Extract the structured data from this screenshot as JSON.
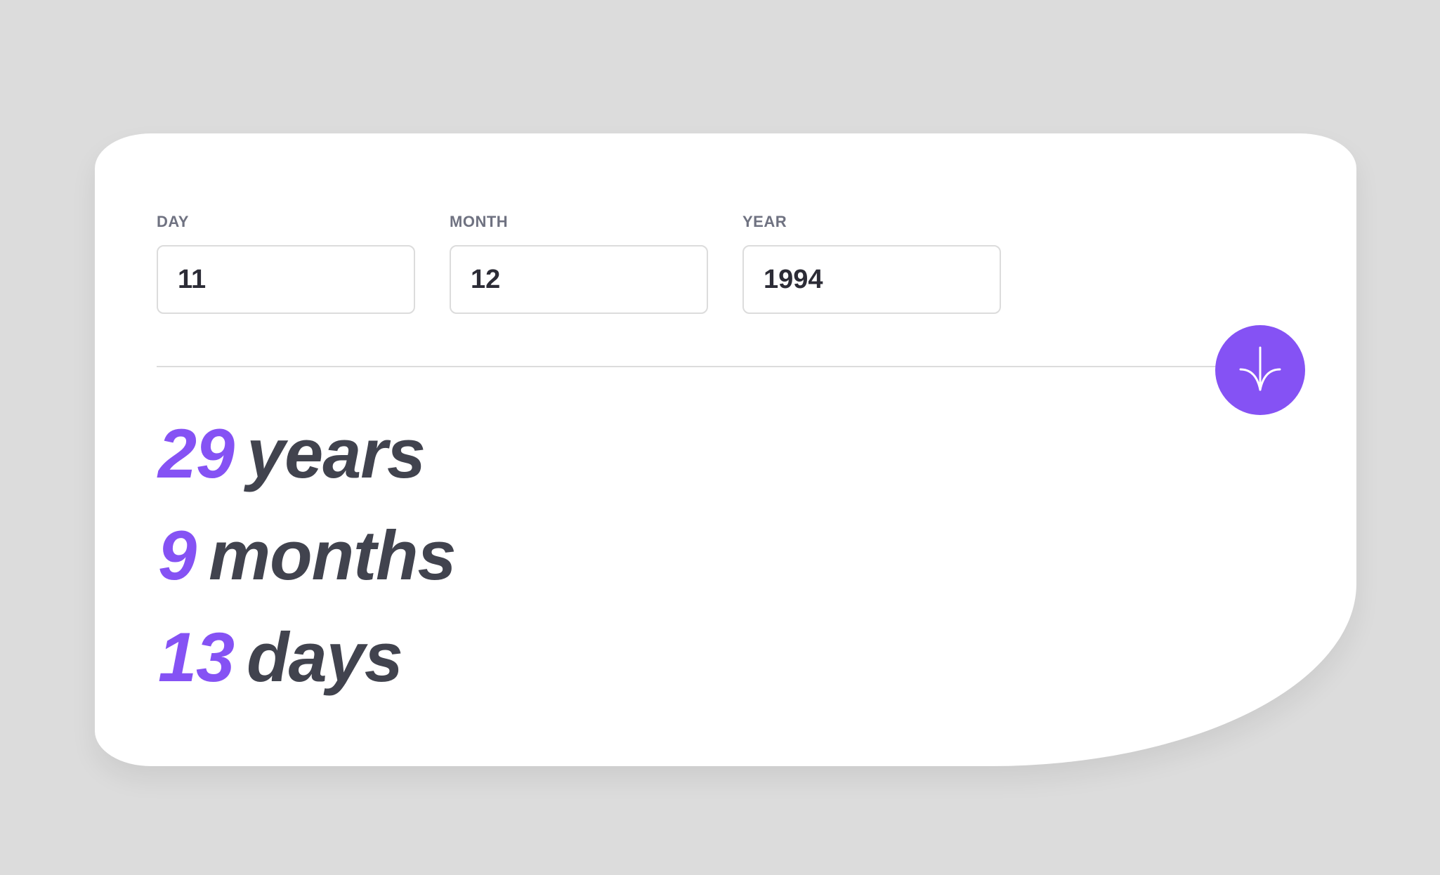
{
  "form": {
    "day": {
      "label": "DAY",
      "value": "11"
    },
    "month": {
      "label": "MONTH",
      "value": "12"
    },
    "year": {
      "label": "YEAR",
      "value": "1994"
    }
  },
  "submit": {
    "icon": "arrow-down-icon"
  },
  "results": {
    "years": {
      "value": "29",
      "unit": "years"
    },
    "months": {
      "value": "9",
      "unit": "months"
    },
    "days": {
      "value": "13",
      "unit": "days"
    }
  },
  "colors": {
    "accent": "#8552f4",
    "text_dark": "#41434e",
    "label": "#6f7281",
    "background": "#dcdcdc",
    "card": "#ffffff",
    "border": "#dcdcdc"
  }
}
